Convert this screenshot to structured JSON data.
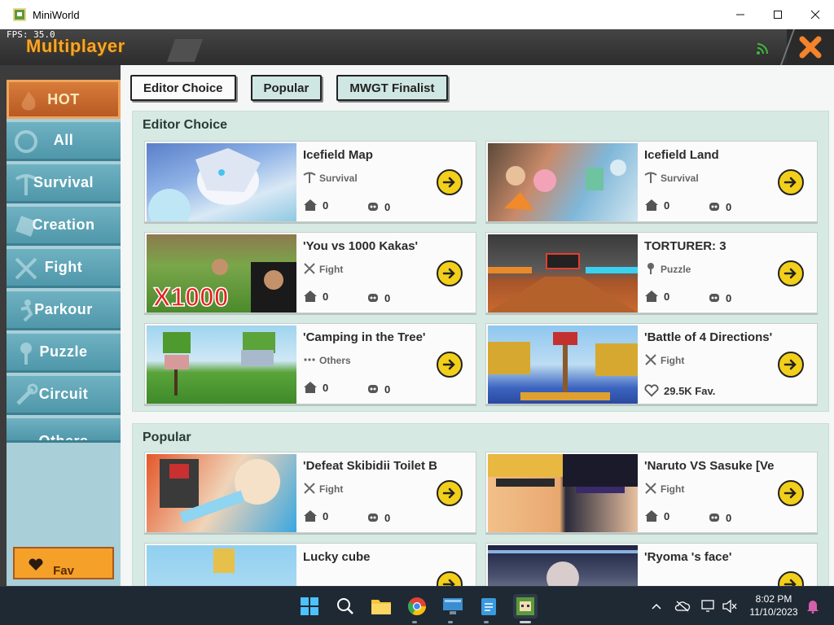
{
  "window": {
    "title": "MiniWorld",
    "minimize": "—",
    "maximize": "☐",
    "close": "✕"
  },
  "header": {
    "fps": "FPS: 35.0",
    "title": "Multiplayer"
  },
  "sidebar": {
    "items": [
      {
        "label": "HOT",
        "active": true
      },
      {
        "label": "All"
      },
      {
        "label": "Survival"
      },
      {
        "label": "Creation"
      },
      {
        "label": "Fight"
      },
      {
        "label": "Parkour"
      },
      {
        "label": "Puzzle"
      },
      {
        "label": "Circuit"
      },
      {
        "label": "Others"
      }
    ],
    "fav_label": "Fav"
  },
  "tabs": [
    {
      "label": "Editor Choice",
      "selected": true
    },
    {
      "label": "Popular"
    },
    {
      "label": "MWGT Finalist"
    }
  ],
  "sections": [
    {
      "title": "Editor Choice",
      "cards": [
        {
          "title": "Icefield Map",
          "category": "Survival",
          "category_icon": "pickaxe-icon",
          "homes": "0",
          "players": "0"
        },
        {
          "title": "Icefield Land",
          "category": "Survival",
          "category_icon": "pickaxe-icon",
          "homes": "0",
          "players": "0"
        },
        {
          "title": "'You vs 1000 Kakas'",
          "category": "Fight",
          "category_icon": "crossed-swords-icon",
          "homes": "0",
          "players": "0",
          "thumb_text": "X1000"
        },
        {
          "title": "TORTURER: 3",
          "category": "Puzzle",
          "category_icon": "key-icon",
          "homes": "0",
          "players": "0"
        },
        {
          "title": "'Camping in the Tree'",
          "category": "Others",
          "category_icon": "dots-icon",
          "homes": "0",
          "players": "0"
        },
        {
          "title": "'Battle of 4 Directions'",
          "category": "Fight",
          "category_icon": "crossed-swords-icon",
          "favs": "29.5K Fav."
        }
      ]
    },
    {
      "title": "Popular",
      "cards": [
        {
          "title": "'Defeat Skibidii Toilet B",
          "category": "Fight",
          "category_icon": "crossed-swords-icon",
          "homes": "0",
          "players": "0"
        },
        {
          "title": "'Naruto VS Sasuke [Ve",
          "category": "Fight",
          "category_icon": "crossed-swords-icon",
          "homes": "0",
          "players": "0"
        },
        {
          "title": "Lucky cube",
          "category": "",
          "category_icon": "dots-icon"
        },
        {
          "title": "'Ryoma 's face'",
          "category": "",
          "category_icon": "crossed-swords-icon"
        }
      ]
    }
  ],
  "taskbar": {
    "time": "8:02 PM",
    "date": "11/10/2023"
  },
  "colors": {
    "accent_orange": "#f3a533",
    "sidebar_blue": "#5ea6b8",
    "go_yellow": "#f2cf1a",
    "panel_green": "#d6e9e3"
  }
}
